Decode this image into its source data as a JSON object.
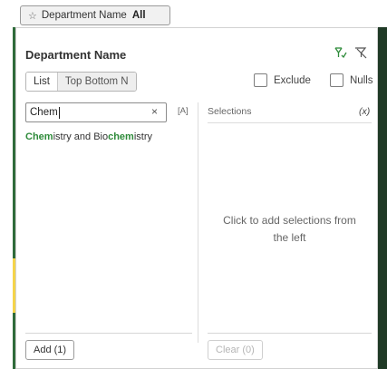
{
  "filter_pill": {
    "field": "Department Name",
    "value": "All"
  },
  "panel": {
    "title": "Department Name",
    "icons": [
      "select-all-icon",
      "clear-filter-icon"
    ],
    "tabs": [
      {
        "label": "List",
        "selected": true
      },
      {
        "label": "Top Bottom N",
        "selected": false
      }
    ],
    "exclude_label": "Exclude",
    "nulls_label": "Nulls",
    "search": {
      "value": "Chem",
      "clear_glyph": "×",
      "match_case_label": "[A]"
    },
    "results": [
      {
        "parts": [
          {
            "text": "Chem",
            "hl": true
          },
          {
            "text": "istry and Bio",
            "hl": false
          },
          {
            "text": "chem",
            "hl": true
          },
          {
            "text": "istry",
            "hl": false
          }
        ]
      }
    ],
    "selections": {
      "title": "Selections",
      "clear_x_label": "(x)",
      "empty_line1": "Click to add selections from",
      "empty_line2": "the left"
    },
    "add_button": "Add (1)",
    "clear_button": "Clear (0)"
  },
  "colors": {
    "highlight": "#2e8b3a",
    "side_green": "#2f6b3a",
    "accent_yellow": "#f5d44a"
  }
}
